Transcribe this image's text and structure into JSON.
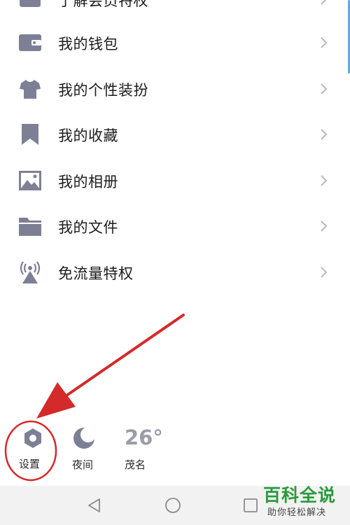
{
  "menu": {
    "items": [
      {
        "label": "了解会员特权",
        "icon": "crown-icon"
      },
      {
        "label": "我的钱包",
        "icon": "wallet-icon"
      },
      {
        "label": "我的个性装扮",
        "icon": "shirt-icon"
      },
      {
        "label": "我的收藏",
        "icon": "bookmark-icon"
      },
      {
        "label": "我的相册",
        "icon": "photo-icon"
      },
      {
        "label": "我的文件",
        "icon": "folder-icon"
      },
      {
        "label": "免流量特权",
        "icon": "signal-tower-icon"
      }
    ]
  },
  "bottom": {
    "settings_label": "设置",
    "night_label": "夜间",
    "temperature": "26°",
    "city": "茂名"
  },
  "watermark": {
    "title": "百科全说",
    "subtitle": "助你轻松解决"
  },
  "colors": {
    "icon_gray": "#7d8095",
    "annotation_red": "#d42a2a",
    "watermark_green": "#2a9a3c"
  }
}
